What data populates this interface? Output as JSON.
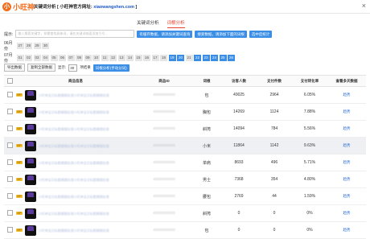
{
  "header": {
    "logo_mark": "小",
    "logo_text": "小旺神",
    "title": "关键词分析 [ 小旺神官方网址:",
    "site": "xiaowangshen.com",
    "title_end": "]",
    "close": "×"
  },
  "tabs": [
    "关键词分析",
    "词根分析"
  ],
  "hint": {
    "label": "提示:",
    "placeholder": "输入搜索关键字，如需查找具体词，请在关键词前面添加引号...",
    "buttons": [
      "有缓存数据，请添加关键词查询",
      "搜索数据，请添加下面的词根",
      "选中后统计"
    ]
  },
  "months": [
    {
      "label": "06月份",
      "days": [
        "27",
        "28",
        "29",
        "30"
      ],
      "selected": []
    },
    {
      "label": "07月份",
      "days": [
        "01",
        "02",
        "03",
        "04",
        "05",
        "06",
        "07",
        "08",
        "09",
        "10",
        "11",
        "12",
        "13",
        "14",
        "15",
        "16",
        "17",
        "18",
        "19",
        "20",
        "21",
        "22",
        "23",
        "24",
        "25",
        "26"
      ],
      "selected": [
        "19",
        "20",
        "22",
        "23",
        "24",
        "25",
        "26"
      ]
    }
  ],
  "controls": {
    "export": "导出数据",
    "copy": "复制全部数据",
    "show_label": "显示:",
    "show_value": "30",
    "unit": "项结果",
    "analyze": "词根分析(手动分词)"
  },
  "table": {
    "columns": [
      "",
      "商品信息",
      "商品ID",
      "词根",
      "访客人数",
      "支付件数",
      "支付转化率",
      "查看多天数据"
    ],
    "rows": [
      {
        "title": "小旺神宝贝标题模糊处理小旺神宝贝标题模糊处理",
        "id": "40000000000",
        "root": "包",
        "visitors": "49025",
        "orders": "2964",
        "rate": "6.05%",
        "trend": "趋势",
        "hl": false
      },
      {
        "title": "小旺神宝贝标题模糊处理小旺神宝贝标题模糊处理",
        "id": "40000000000",
        "root": "胸包",
        "visitors": "14269",
        "orders": "1124",
        "rate": "7.88%",
        "trend": "趋势",
        "hl": false
      },
      {
        "title": "小旺神宝贝标题模糊处理小旺神宝贝标题模糊处理",
        "id": "40000000000",
        "root": "斜挎",
        "visitors": "14094",
        "orders": "784",
        "rate": "5.56%",
        "trend": "趋势",
        "hl": false
      },
      {
        "title": "小旺神宝贝标题模糊处理小旺神宝贝标题模糊处理",
        "id": "40000000000",
        "root": "小米",
        "visitors": "11864",
        "orders": "1142",
        "rate": "9.63%",
        "trend": "趋势",
        "hl": true
      },
      {
        "title": "小旺神宝贝标题模糊处理小旺神宝贝标题模糊处理",
        "id": "40000000000",
        "root": "单肩",
        "visitors": "8693",
        "orders": "496",
        "rate": "5.71%",
        "trend": "趋势",
        "hl": false
      },
      {
        "title": "小旺神宝贝标题模糊处理小旺神宝贝标题模糊处理",
        "id": "40000000000",
        "root": "男士",
        "visitors": "7368",
        "orders": "354",
        "rate": "4.80%",
        "trend": "趋势",
        "hl": false
      },
      {
        "title": "小旺神宝贝标题模糊处理小旺神宝贝标题模糊处理",
        "id": "40000000000",
        "root": "腰包",
        "visitors": "2769",
        "orders": "44",
        "rate": "1.59%",
        "trend": "趋势",
        "hl": false
      },
      {
        "title": "小旺神宝贝标题模糊处理小旺神宝贝标题模糊处理",
        "id": "40000000000",
        "root": "斜挎",
        "visitors": "0",
        "orders": "0",
        "rate": "0%",
        "trend": "趋势",
        "hl": false
      },
      {
        "title": "小旺神宝贝标题模糊处理小旺神宝贝标题模糊处理",
        "id": "40000000000",
        "root": "包",
        "visitors": "0",
        "orders": "0",
        "rate": "0%",
        "trend": "趋势",
        "hl": false
      }
    ]
  },
  "badge": "VIP",
  "colors": {
    "accent": "#3a8ee6",
    "brand": "#f26c1b",
    "active_tab": "#e8432e"
  }
}
